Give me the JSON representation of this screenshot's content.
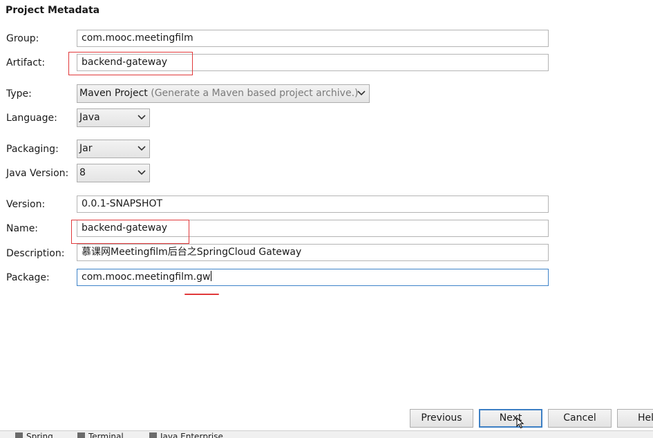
{
  "section_title": "Project Metadata",
  "fields": {
    "group": {
      "label": "Group:",
      "value": "com.mooc.meetingfilm"
    },
    "artifact": {
      "label": "Artifact:",
      "value": "backend-gateway"
    },
    "type": {
      "label": "Type:",
      "value": "Maven Project",
      "hint": "(Generate a Maven based project archive.)"
    },
    "language": {
      "label": "Language:",
      "value": "Java"
    },
    "packaging": {
      "label": "Packaging:",
      "value": "Jar"
    },
    "java_version": {
      "label": "Java Version:",
      "value": "8"
    },
    "version": {
      "label": "Version:",
      "value": "0.0.1-SNAPSHOT"
    },
    "name": {
      "label": "Name:",
      "value": "backend-gateway"
    },
    "description": {
      "label": "Description:",
      "value": "慕课网Meetingfilm后台之SpringCloud Gateway"
    },
    "package": {
      "label": "Package:",
      "value": "com.mooc.meetingfilm.gw"
    }
  },
  "buttons": {
    "previous": "Previous",
    "next": "Next",
    "cancel": "Cancel",
    "help": "Help"
  },
  "bottom_tabs": [
    "Spring",
    "Terminal",
    "Java Enterprise"
  ],
  "colors": {
    "annotation_red": "#e0383a",
    "focus_blue": "#3d82c8"
  }
}
